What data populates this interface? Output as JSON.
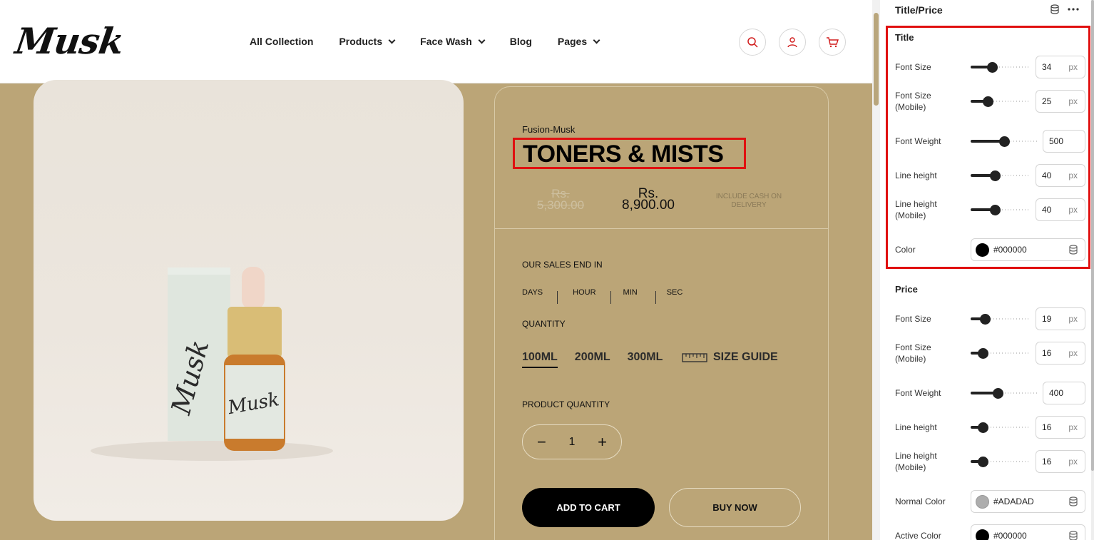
{
  "store": {
    "logo": "Musk",
    "nav": [
      {
        "label": "All Collection",
        "dropdown": false
      },
      {
        "label": "Products",
        "dropdown": true
      },
      {
        "label": "Face Wash",
        "dropdown": true
      },
      {
        "label": "Blog",
        "dropdown": false
      },
      {
        "label": "Pages",
        "dropdown": true
      }
    ],
    "header_icons": [
      "search-icon",
      "user-icon",
      "cart-icon"
    ],
    "product": {
      "vendor": "Fusion-Musk",
      "title": "TONERS & MISTS",
      "old_price_line1": "Rs.",
      "old_price_line2": "5,300.00",
      "new_price_line1": "Rs.",
      "new_price_line2": "8,900.00",
      "cod_note": "INCLUDE CASH ON DELIVERY",
      "sales_label": "OUR SALES END IN",
      "timer_units": [
        "DAYS",
        "HOUR",
        "MIN",
        "SEC"
      ],
      "quantity_label": "QUANTITY",
      "sizes": [
        "100ML",
        "200ML",
        "300ML"
      ],
      "active_size": "100ML",
      "size_guide": "SIZE GUIDE",
      "product_quantity_label": "PRODUCT QUANTITY",
      "quantity_value": "1",
      "add_to_cart": "ADD TO CART",
      "buy_now": "BUY NOW"
    }
  },
  "panel": {
    "title": "Title/Price",
    "title_section": {
      "heading": "Title",
      "rows": [
        {
          "label": "Font Size",
          "value": "34",
          "unit": "px",
          "level": 0.36
        },
        {
          "label": "Font Size (Mobile)",
          "value": "25",
          "unit": "px",
          "level": 0.28
        },
        {
          "label": "Font Weight",
          "value": "500",
          "unit": "",
          "level": 0.5
        },
        {
          "label": "Line height",
          "value": "40",
          "unit": "px",
          "level": 0.4
        },
        {
          "label": "Line height (Mobile)",
          "value": "40",
          "unit": "px",
          "level": 0.4
        }
      ],
      "color_label": "Color",
      "color_value": "#000000"
    },
    "price_section": {
      "heading": "Price",
      "rows": [
        {
          "label": "Font Size",
          "value": "19",
          "unit": "px",
          "level": 0.24
        },
        {
          "label": "Font Size (Mobile)",
          "value": "16",
          "unit": "px",
          "level": 0.2
        },
        {
          "label": "Font Weight",
          "value": "400",
          "unit": "",
          "level": 0.4
        },
        {
          "label": "Line height",
          "value": "16",
          "unit": "px",
          "level": 0.2
        },
        {
          "label": "Line height (Mobile)",
          "value": "16",
          "unit": "px",
          "level": 0.2
        }
      ],
      "normal_color_label": "Normal Color",
      "normal_color_value": "#ADADAD",
      "active_color_label": "Active Color",
      "active_color_value": "#000000"
    }
  },
  "colors": {
    "store_bg": "#bba577",
    "highlight": "#e01010",
    "button_dark": "#000000",
    "icon_red": "#d11c1c"
  }
}
